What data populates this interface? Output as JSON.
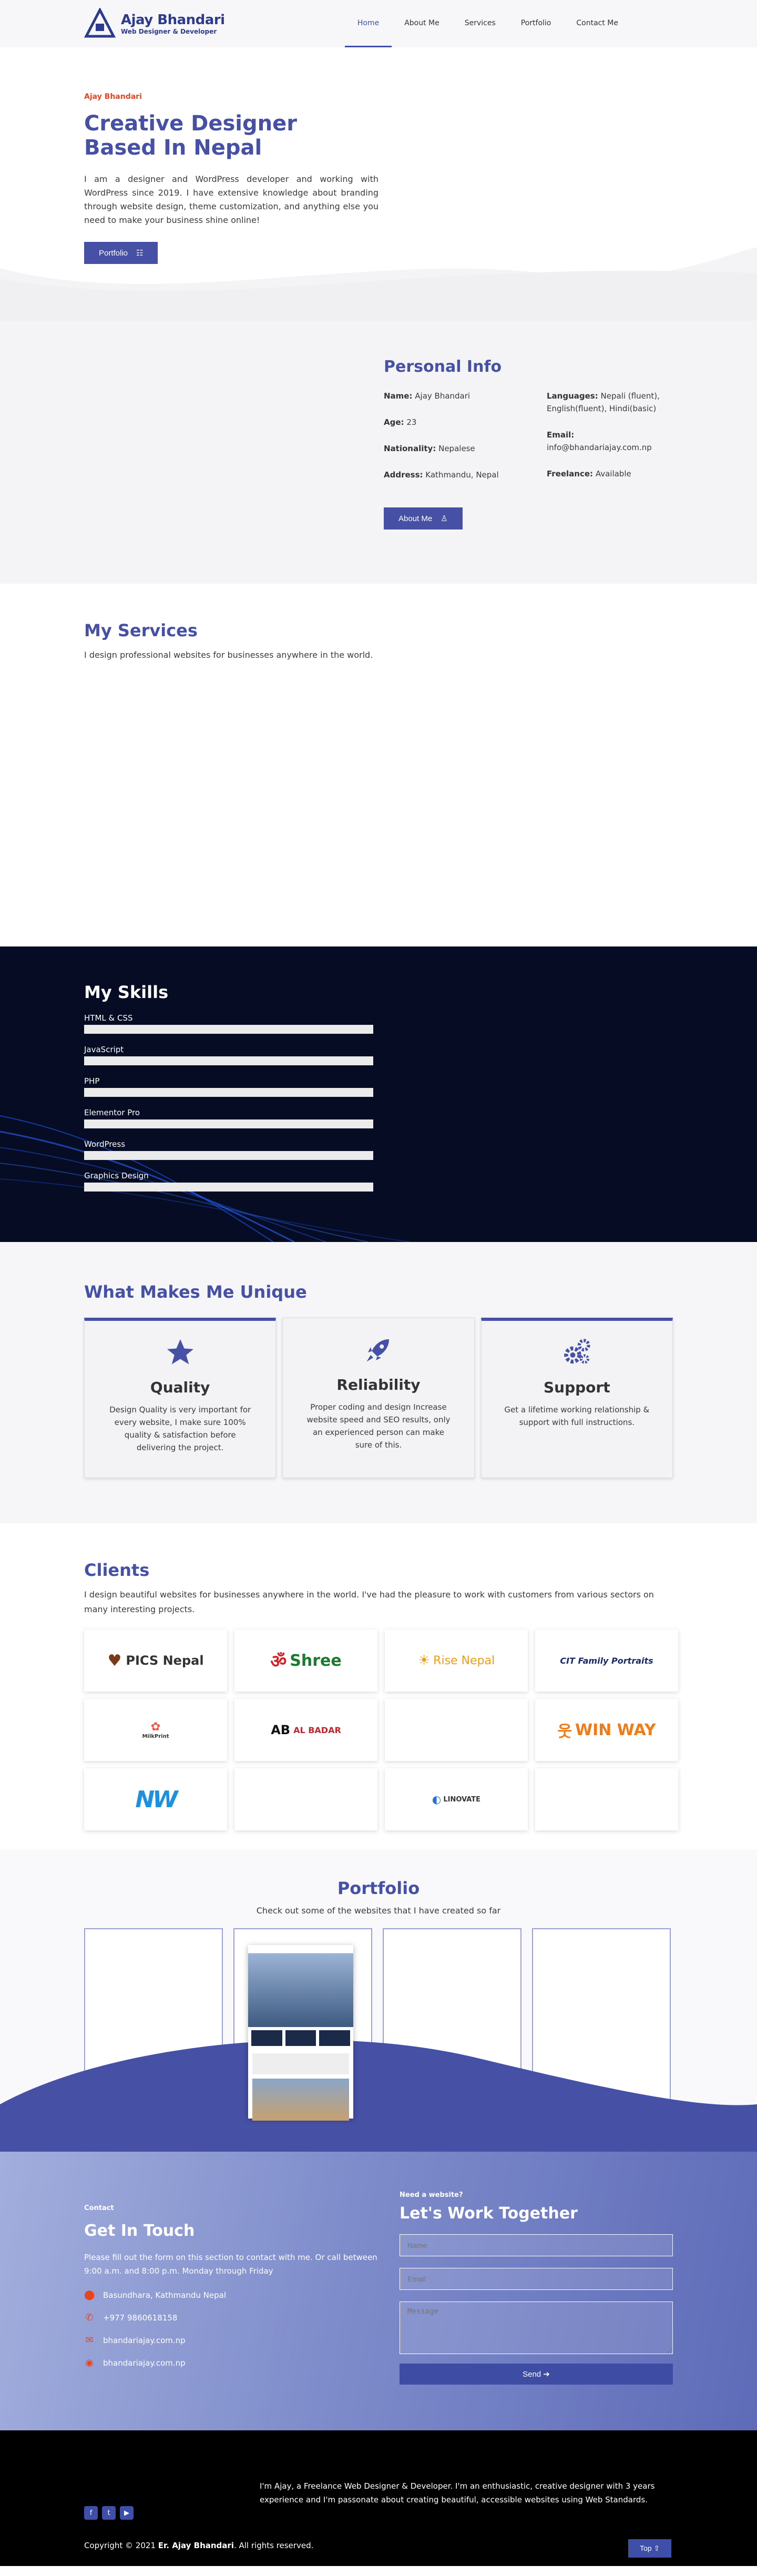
{
  "brand": {
    "name": "Ajay Bhandari",
    "tagline": "Web Designer & Developer"
  },
  "nav": [
    {
      "label": "Home"
    },
    {
      "label": "About Me"
    },
    {
      "label": "Services"
    },
    {
      "label": "Portfolio"
    },
    {
      "label": "Contact Me"
    }
  ],
  "hero": {
    "eyebrow": "Ajay Bhandari",
    "title_line1": "Creative Designer",
    "title_line2": "Based In Nepal",
    "body": "I am a designer and WordPress developer and working with WordPress since 2019. I have extensive knowledge about branding through website design, theme customization, and anything else you need to make your business shine online!",
    "button": "Portfolio"
  },
  "personal": {
    "title": "Personal Info",
    "left": [
      {
        "k": "Name:",
        "v": "Ajay Bhandari"
      },
      {
        "k": "Age:",
        "v": "23"
      },
      {
        "k": "Nationality:",
        "v": "Nepalese"
      },
      {
        "k": "Address:",
        "v": "Kathmandu, Nepal"
      }
    ],
    "right": [
      {
        "k": "Languages:",
        "v": "Nepali (fluent), English(fluent), Hindi(basic)"
      },
      {
        "k": "Email:",
        "v": "info@bhandariajay.com.np"
      },
      {
        "k": "Freelance:",
        "v": "Available"
      }
    ],
    "button": "About Me"
  },
  "services": {
    "title": "My Services",
    "body": "I design professional websites for businesses anywhere in the world."
  },
  "skills": {
    "title": "My Skills",
    "items": [
      {
        "label": "HTML & CSS"
      },
      {
        "label": "JavaScript"
      },
      {
        "label": "PHP"
      },
      {
        "label": "Elementor Pro"
      },
      {
        "label": "WordPress"
      },
      {
        "label": "Graphics Design"
      }
    ]
  },
  "unique": {
    "title": "What Makes Me Unique",
    "cards": [
      {
        "title": "Quality",
        "icon": "star-icon",
        "body": "Design Quality is very important for every website, I make sure 100% quality & satisfaction before delivering the project."
      },
      {
        "title": "Reliability",
        "icon": "rocket-icon",
        "body": "Proper coding and design Increase website speed and SEO results, only an experienced person can make sure of this."
      },
      {
        "title": "Support",
        "icon": "gears-icon",
        "body": "Get a lifetime working relationship & support with full instructions."
      }
    ]
  },
  "clients": {
    "title": "Clients",
    "body": "I design beautiful websites for businesses anywhere in the world. I've had the pleasure to work with customers from various sectors on many interesting projects.",
    "logos": [
      "PICS Nepal",
      "Shree",
      "Rise Nepal",
      "CIT Family Portraits",
      "MilkPrint",
      "AL BADAR",
      "",
      "WIN WAY",
      "NW",
      "",
      "LINOVATE",
      ""
    ]
  },
  "portfolio": {
    "title": "Portfolio",
    "subtitle": "Check out some of the websites that I have created so far"
  },
  "contact": {
    "eyebrow": "Contact",
    "title": "Get In Touch",
    "body": "Please fill out the form on this section to contact with me. Or call between 9:00 a.m. and 8:00 p.m. Monday through Friday",
    "items": [
      {
        "icon": "map-pin-icon",
        "text": "Basundhara, Kathmandu Nepal"
      },
      {
        "icon": "phone-icon",
        "text": "+977 9860618158"
      },
      {
        "icon": "mail-icon",
        "text": "bhandariajay.com.np"
      },
      {
        "icon": "globe-icon",
        "text": "bhandariajay.com.np"
      }
    ],
    "form_eyebrow": "Need a website?",
    "form_title": "Let's Work Together",
    "name_ph": "Name",
    "email_ph": "Email",
    "msg_ph": "Message",
    "send": "Send ➔"
  },
  "footer": {
    "about": "I'm Ajay, a Freelance Web Designer & Developer. I'm an enthusiastic, creative designer with 3 years experience and I'm passonate about creating beautiful, accessible websites using Web Standards.",
    "copy_prefix": "Copyright © 2021",
    "copy_name": "Er. Ajay Bhandari",
    "copy_suffix": ". All rights reserved.",
    "top": "Top ⇧"
  },
  "colors": {
    "primary": "#4651a6",
    "accent": "#e8451e",
    "dark": "#050c24"
  }
}
